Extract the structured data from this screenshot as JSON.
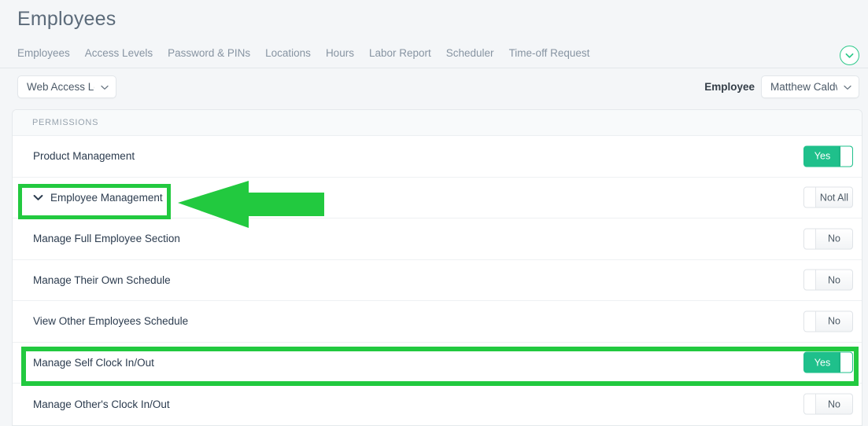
{
  "page": {
    "title": "Employees"
  },
  "tabs": [
    {
      "label": "Employees"
    },
    {
      "label": "Access Levels"
    },
    {
      "label": "Password & PINs"
    },
    {
      "label": "Locations"
    },
    {
      "label": "Hours"
    },
    {
      "label": "Labor Report"
    },
    {
      "label": "Scheduler"
    },
    {
      "label": "Time-off Request"
    }
  ],
  "collapse_button": {
    "icon": "chevron-down-icon"
  },
  "filters": {
    "access_level": {
      "value": "Web Access Le...",
      "caret": "chevron-down-icon"
    },
    "employee_label": "Employee",
    "employee": {
      "value": "Matthew Caldw...",
      "caret": "chevron-down-icon"
    }
  },
  "permissions_card": {
    "header": "PERMISSIONS",
    "rows": [
      {
        "label": "Product Management",
        "toggle": "Yes",
        "state": "on",
        "group": false,
        "indent": false
      },
      {
        "label": "Employee Management",
        "toggle": "Not All",
        "state": "off",
        "group": true,
        "indent": false
      },
      {
        "label": "Manage Full Employee Section",
        "toggle": "No",
        "state": "off",
        "group": false,
        "indent": true
      },
      {
        "label": "Manage Their Own Schedule",
        "toggle": "No",
        "state": "off",
        "group": false,
        "indent": true
      },
      {
        "label": "View Other Employees Schedule",
        "toggle": "No",
        "state": "off",
        "group": false,
        "indent": true
      },
      {
        "label": "Manage Self Clock In/Out",
        "toggle": "Yes",
        "state": "on",
        "group": false,
        "indent": true
      },
      {
        "label": "Manage Other's Clock In/Out",
        "toggle": "No",
        "state": "off",
        "group": false,
        "indent": true
      }
    ]
  },
  "annotations": {
    "color": "#22c93f",
    "highlight_group": "Employee Management",
    "highlight_row": "Manage Self Clock In/Out",
    "arrow": "left-pointing-arrow"
  },
  "colors": {
    "toggle_on": "#1fc08b",
    "accent": "#2ec98b",
    "page_bg": "#f4f6f8",
    "title": "#5c6b7a"
  }
}
